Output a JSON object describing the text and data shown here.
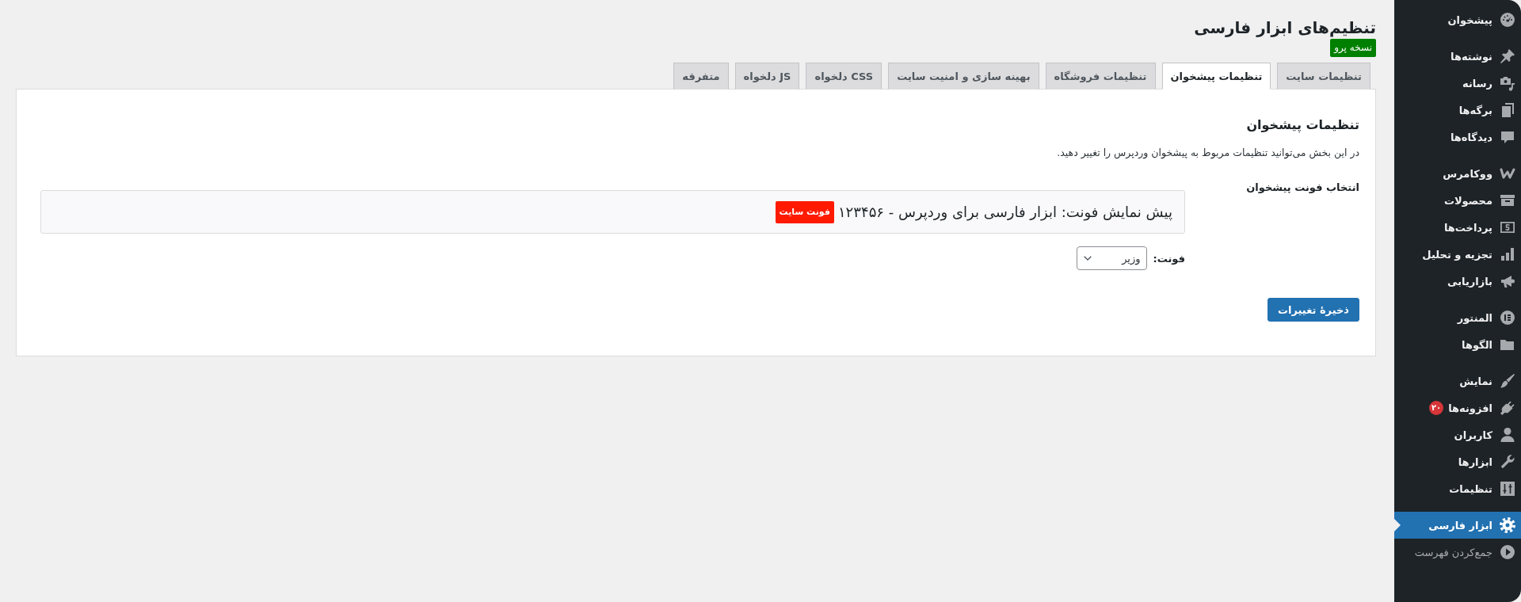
{
  "sidebar": {
    "groups": [
      {
        "items": [
          {
            "label": "پیشخوان",
            "selected": false
          }
        ]
      },
      {
        "items": [
          {
            "label": "نوشته‌ها",
            "selected": false
          },
          {
            "label": "رسانه",
            "selected": false
          },
          {
            "label": "برگه‌ها",
            "selected": false
          },
          {
            "label": "دیدگاه‌ها",
            "selected": false
          }
        ]
      },
      {
        "items": [
          {
            "label": "ووکامرس",
            "selected": false
          },
          {
            "label": "محصولات",
            "selected": false
          },
          {
            "label": "پرداخت‌ها",
            "selected": false
          },
          {
            "label": "تجزیه و تحلیل",
            "selected": false
          },
          {
            "label": "بازاریابی",
            "selected": false
          }
        ]
      },
      {
        "items": [
          {
            "label": "المنتور",
            "selected": false
          },
          {
            "label": "الگوها",
            "selected": false
          }
        ]
      },
      {
        "items": [
          {
            "label": "نمایش",
            "selected": false
          },
          {
            "label": "افزونه‌ها",
            "selected": false,
            "badge": "۲۰"
          },
          {
            "label": "کاربران",
            "selected": false
          },
          {
            "label": "ابزارها",
            "selected": false
          },
          {
            "label": "تنظیمات",
            "selected": false
          }
        ]
      },
      {
        "items": [
          {
            "label": "ابزار فارسی",
            "selected": true
          }
        ]
      }
    ],
    "collapse_label": "جمع‌کردن فهرست"
  },
  "page": {
    "title": "تنظیم‌های ابزار فارسی",
    "version_badge": "نسخه پرو"
  },
  "tabs": [
    {
      "label": "تنظیمات سایت",
      "selected": false
    },
    {
      "label": "تنظیمات پیشخوان",
      "selected": true
    },
    {
      "label": "تنظیمات فروشگاه",
      "selected": false
    },
    {
      "label": "بهینه سازی و امنیت سایت",
      "selected": false
    },
    {
      "label": "CSS دلخواه",
      "selected": false
    },
    {
      "label": "JS دلخواه",
      "selected": false
    },
    {
      "label": "متفرقه",
      "selected": false
    }
  ],
  "panel": {
    "heading": "تنظیمات پیشخوان",
    "description": "در این بخش می‌توانید تنظیمات مربوط به پیشخوان وردپرس را تغییر دهید.",
    "font_setting": {
      "label": "انتخاب فونت پیشخوان",
      "preview_text": "پیش نمایش فونت: ابزار فارسی برای وردپرس - ۱۲۳۴۵۶",
      "preview_badge": "فونت سایت",
      "font_label": "فونت:",
      "font_value": "وزیر"
    },
    "save_button": "ذخیرهٔ تغییرات"
  }
}
